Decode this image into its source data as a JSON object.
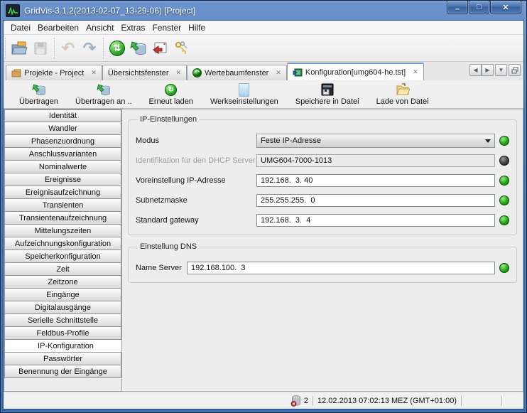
{
  "window": {
    "title": "GridVis-3.1.2(2013-02-07_13-29-06) [Project]",
    "controls": {
      "minimize": "–",
      "maximize": "□",
      "close": "✕"
    }
  },
  "menubar": {
    "items": [
      "Datei",
      "Bearbeiten",
      "Ansicht",
      "Extras",
      "Fenster",
      "Hilfe"
    ]
  },
  "main_toolbar": {
    "icons": [
      "open-project-icon",
      "save-icon",
      "undo-icon",
      "redo-icon",
      "reload-values-icon",
      "transfer-device-icon",
      "import-window-icon",
      "keys-icon"
    ]
  },
  "tabbar": {
    "tabs": [
      {
        "label": "Projekte - Project",
        "icon": "projects-folder-icon"
      },
      {
        "label": "Übersichtsfenster",
        "icon": ""
      },
      {
        "label": "Wertebaumfenster",
        "icon": "value-tree-icon"
      },
      {
        "label": "Konfiguration[umg604-he.tst]",
        "icon": "configuration-icon"
      }
    ],
    "active_tab": "Konfiguration[umg604-he.tst]",
    "close_glyph": "✕",
    "controls": [
      "scroll-left",
      "scroll-right",
      "tab-list-dropdown",
      "maximize-document"
    ]
  },
  "config_toolbar": {
    "buttons": [
      {
        "label": "Übertragen",
        "icon": "transfer-icon"
      },
      {
        "label": "Übertragen an ..",
        "icon": "transfer-to-icon"
      },
      {
        "label": "Erneut laden",
        "icon": "reload-icon"
      },
      {
        "label": "Werkseinstellungen",
        "icon": "factory-settings-icon"
      },
      {
        "label": "Speichere in Datei",
        "icon": "save-to-file-icon"
      },
      {
        "label": "Lade von Datei",
        "icon": "load-from-file-icon"
      }
    ]
  },
  "sidebar": {
    "items": [
      "Identität",
      "Wandler",
      "Phasenzuordnung",
      "Anschlussvarianten",
      "Nominalwerte",
      "Ereignisse",
      "Ereignisaufzeichnung",
      "Transienten",
      "Transientenaufzeichnung",
      "Mittelungszeiten",
      "Aufzeichnungskonfiguration",
      "Speicherkonfiguration",
      "Zeit",
      "Zeitzone",
      "Eingänge",
      "Digitalausgänge",
      "Serielle Schnittstelle",
      "Feldbus-Profile",
      "IP-Konfiguration",
      "Passwörter",
      "Benennung der Eingänge"
    ],
    "selected": "IP-Konfiguration",
    "selected_index": 18
  },
  "panel": {
    "ip_group": {
      "title": "IP-Einstellungen",
      "rows": [
        {
          "label": "Modus",
          "value": "Feste IP-Adresse",
          "control": "combobox",
          "led": "green"
        },
        {
          "label": "Identifikation für den DHCP Server",
          "value": "UMG604-7000-1013",
          "control": "textfield-disabled",
          "led": "dark"
        },
        {
          "label": "Voreinstellung IP-Adresse",
          "value": "192.168.  3. 40",
          "control": "textfield",
          "led": "green"
        },
        {
          "label": "Subnetzmaske",
          "value": "255.255.255.  0",
          "control": "textfield",
          "led": "green"
        },
        {
          "label": "Standard gateway",
          "value": "192.168.  3.  4",
          "control": "textfield",
          "led": "green"
        }
      ]
    },
    "dns_group": {
      "title": "Einstellung DNS",
      "rows": [
        {
          "label": "Name Server",
          "value": "192.168.100.  3",
          "control": "textfield",
          "led": "green"
        }
      ]
    }
  },
  "statusbar": {
    "db_count": "2",
    "datetime": "12.02.2013 07:02:13 MEZ (GMT+01:00)",
    "icon": "database-error-icon"
  },
  "colors": {
    "frame_blue": "#3f6fb5",
    "led_green": "#2cb11e",
    "led_dark": "#3c3c3c",
    "accent_green": "#3fae49",
    "tab_active_highlight": "#6f9bd0",
    "content_bg": "#ededed"
  }
}
